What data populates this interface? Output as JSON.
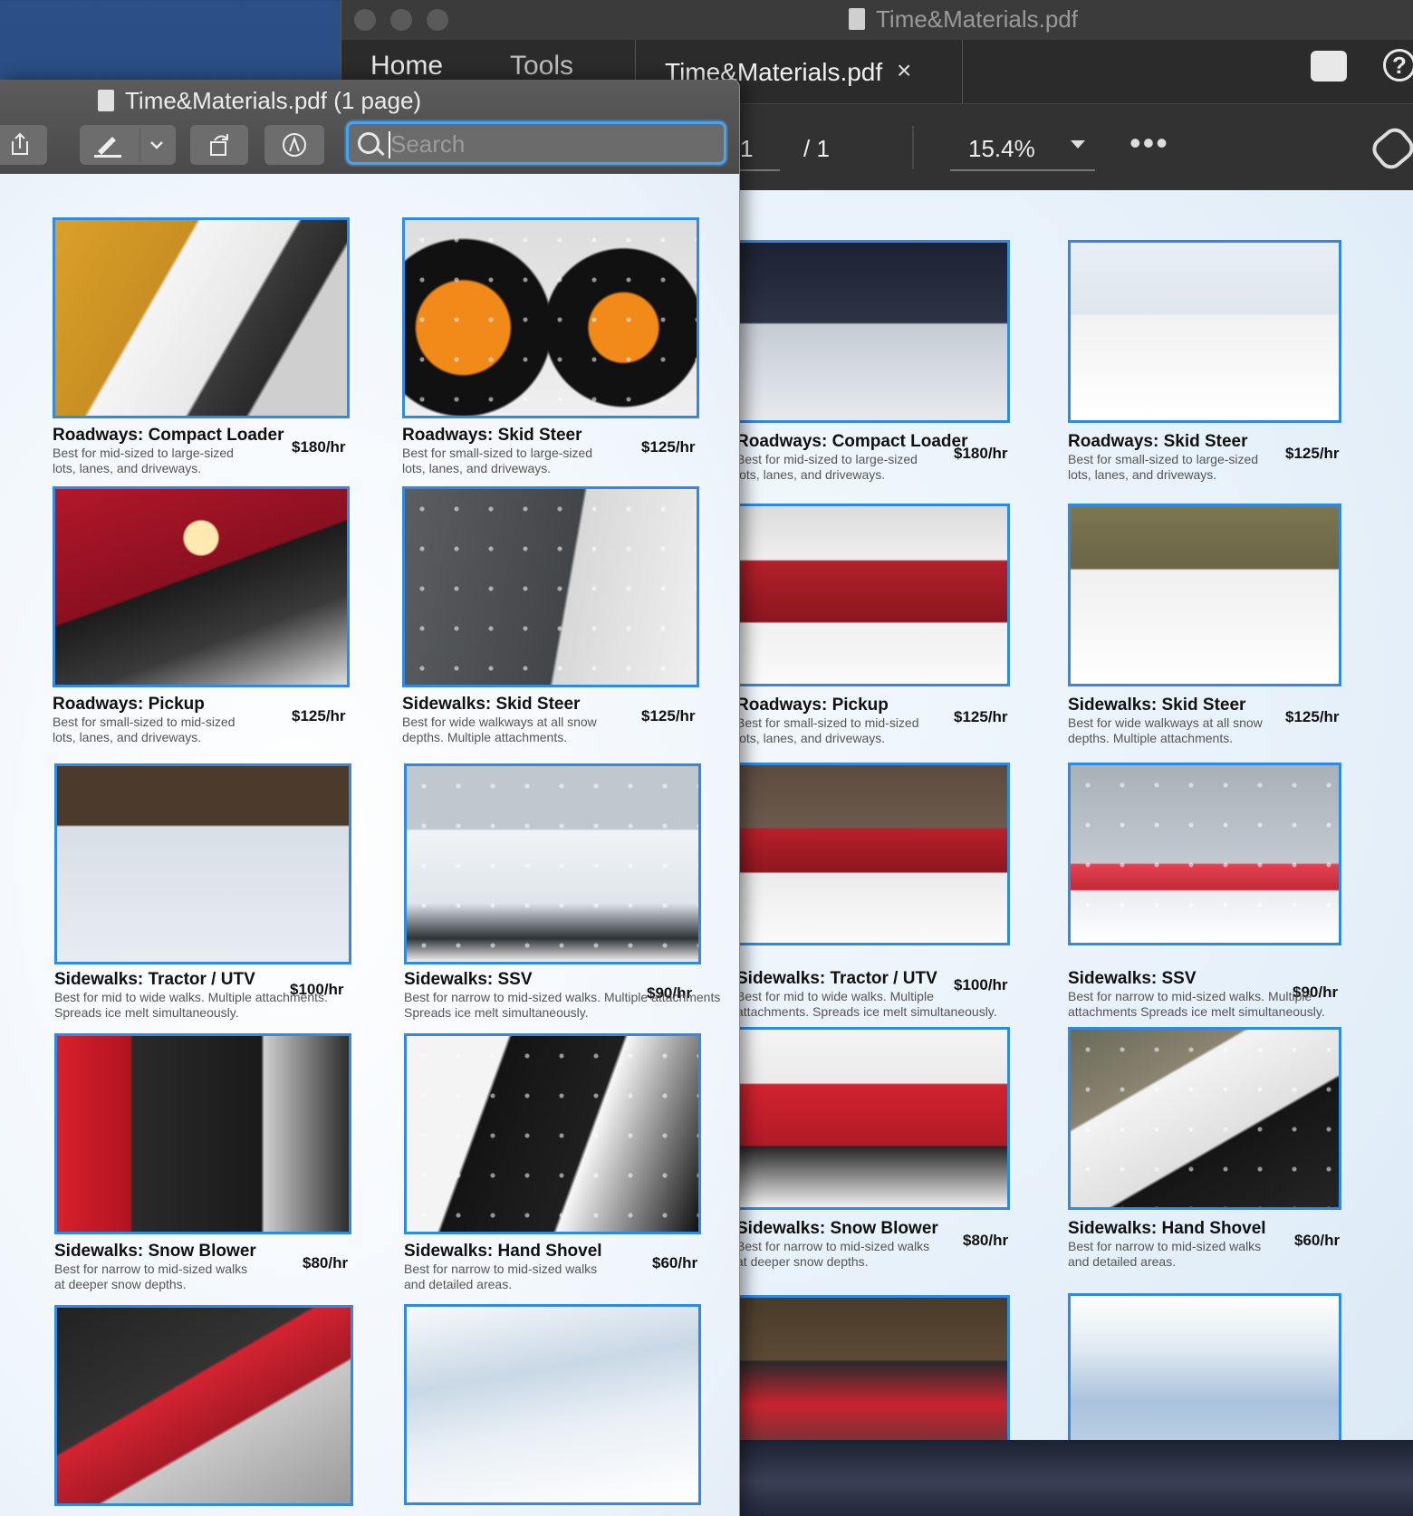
{
  "back_window": {
    "title": "Time&Materials.pdf",
    "tabs": [
      "Home",
      "Tools"
    ],
    "doc_tab": "Time&Materials.pdf",
    "close_glyph": "×",
    "page_current": "1",
    "page_total": "/ 1",
    "zoom": "15.4%",
    "more_glyph": "•••",
    "help_glyph": "?"
  },
  "front_window": {
    "title": "Time&Materials.pdf (1 page)",
    "search_placeholder": "Search"
  },
  "cards": [
    {
      "title": "Roadways: Compact Loader",
      "price": "$180/hr",
      "desc": "Best for mid-sized to large-sized lots, lanes, and driveways."
    },
    {
      "title": "Roadways: Skid Steer",
      "price": "$125/hr",
      "desc": "Best for small-sized to large-sized lots, lanes, and driveways."
    },
    {
      "title": "Roadways: Pickup",
      "price": "$125/hr",
      "desc": "Best for small-sized to mid-sized lots, lanes, and driveways."
    },
    {
      "title": "Sidewalks: Skid Steer",
      "price": "$125/hr",
      "desc": "Best for wide walkways at all snow depths. Multiple attachments."
    },
    {
      "title": "Sidewalks: Tractor / UTV",
      "price": "$100/hr",
      "desc": "Best for mid to wide walks. Multiple attachments. Spreads ice melt simultaneously."
    },
    {
      "title": "Sidewalks: SSV",
      "price": "$90/hr",
      "desc": "Best for narrow to mid-sized walks. Multiple attachments Spreads ice melt simultaneously."
    },
    {
      "title": "Sidewalks: Snow Blower",
      "price": "$80/hr",
      "desc": "Best for narrow to mid-sized walks at deeper snow depths."
    },
    {
      "title": "Sidewalks: Hand Shovel",
      "price": "$60/hr",
      "desc": "Best for narrow to mid-sized walks and detailed areas."
    }
  ]
}
